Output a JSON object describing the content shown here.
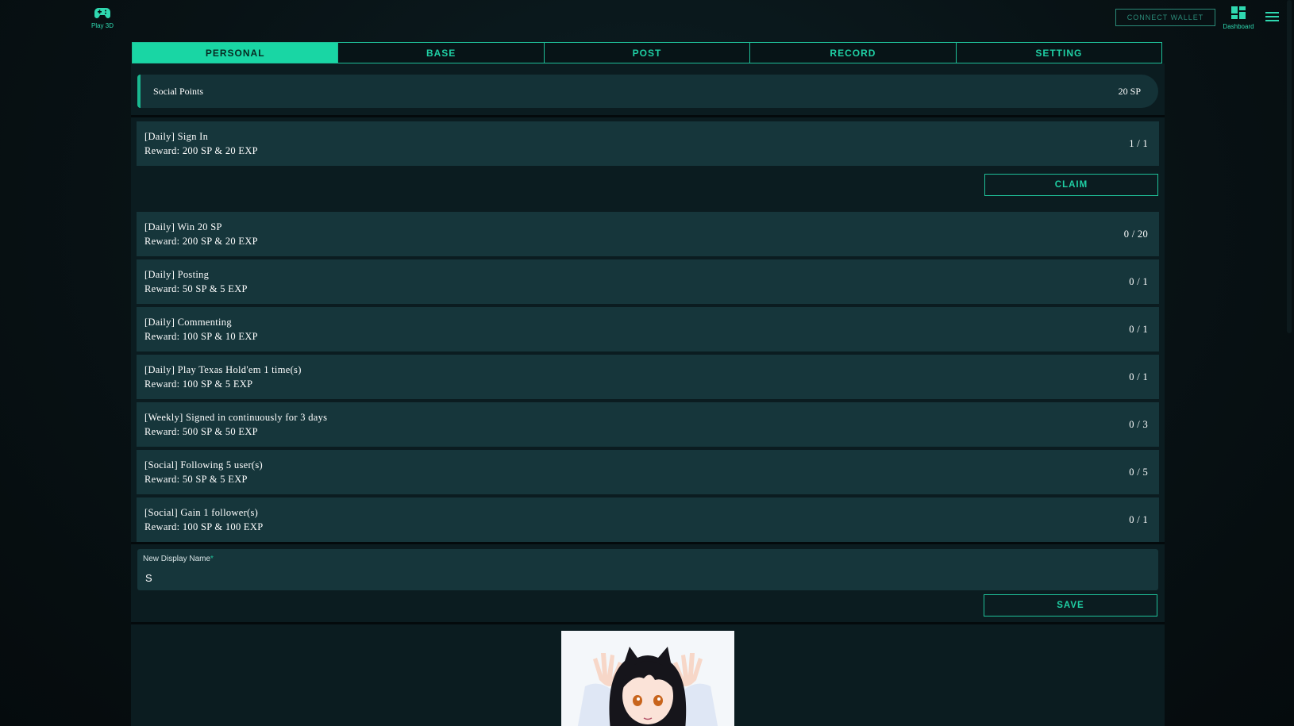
{
  "header": {
    "play3d_label": "Play 3D",
    "connect_wallet_label": "CONNECT WALLET",
    "dashboard_label": "Dashboard"
  },
  "tabs": [
    {
      "label": "PERSONAL",
      "active": true
    },
    {
      "label": "BASE",
      "active": false
    },
    {
      "label": "POST",
      "active": false
    },
    {
      "label": "RECORD",
      "active": false
    },
    {
      "label": "SETTING",
      "active": false
    }
  ],
  "social_points": {
    "label": "Social Points",
    "value": "20 SP"
  },
  "tasks": [
    {
      "title": "[Daily] Sign In",
      "reward": "Reward: 200 SP & 20 EXP",
      "progress": "1 / 1"
    },
    {
      "title": "[Daily] Win 20 SP",
      "reward": "Reward: 200 SP & 20 EXP",
      "progress": "0 / 20"
    },
    {
      "title": "[Daily] Posting",
      "reward": "Reward: 50 SP & 5 EXP",
      "progress": "0 / 1"
    },
    {
      "title": "[Daily] Commenting",
      "reward": "Reward: 100 SP & 10 EXP",
      "progress": "0 / 1"
    },
    {
      "title": "[Daily] Play Texas Hold'em 1 time(s)",
      "reward": "Reward: 100 SP & 5 EXP",
      "progress": "0 / 1"
    },
    {
      "title": "[Weekly] Signed in continuously for 3 days",
      "reward": "Reward: 500 SP & 50 EXP",
      "progress": "0 / 3"
    },
    {
      "title": "[Social] Following 5 user(s)",
      "reward": "Reward: 50 SP & 5 EXP",
      "progress": "0 / 5"
    },
    {
      "title": "[Social] Gain 1 follower(s)",
      "reward": "Reward: 100 SP & 100 EXP",
      "progress": "0 / 1"
    }
  ],
  "claim_label": "CLAIM",
  "display_name": {
    "label": "New Display Name",
    "required_mark": "*",
    "value": "S"
  },
  "save_label": "SAVE",
  "colors": {
    "accent": "#19d6a4",
    "panel": "#0b1c20",
    "card": "#16363b"
  }
}
